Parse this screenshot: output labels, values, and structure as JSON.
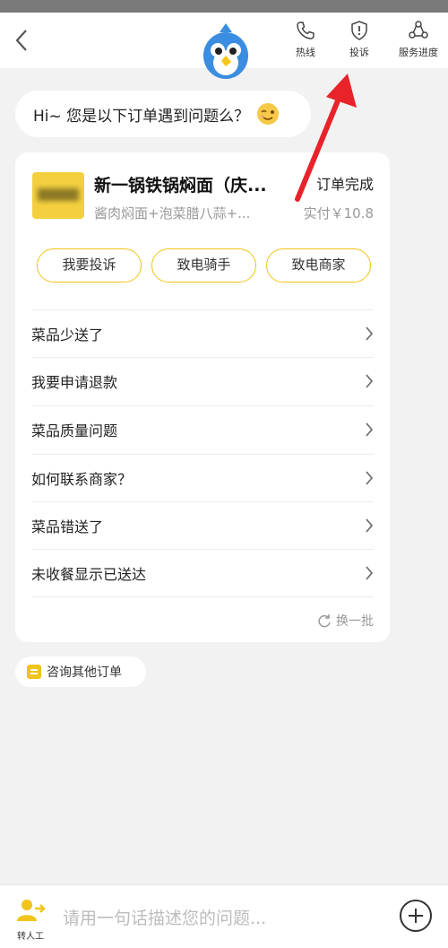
{
  "header": {
    "actions": [
      {
        "icon": "phone-icon",
        "label": "热线"
      },
      {
        "icon": "shield-icon",
        "label": "投诉"
      },
      {
        "icon": "progress-icon",
        "label": "服务进度"
      }
    ]
  },
  "greeting": {
    "text": "Hi~ 您是以下订单遇到问题么？",
    "emoji": "wink-emoji-icon"
  },
  "order": {
    "store_name": "新一锅铁锅焖面（庆...",
    "status": "订单完成",
    "items": "酱肉焖面+泡菜腊八蒜+...",
    "paid": "实付￥10.8"
  },
  "order_actions": [
    "我要投诉",
    "致电骑手",
    "致电商家"
  ],
  "questions": [
    "菜品少送了",
    "我要申请退款",
    "菜品质量问题",
    "如何联系商家？",
    "菜品错送了",
    "未收餐显示已送达"
  ],
  "refresh_label": "换一批",
  "other_orders_label": "咨询其他订单",
  "bottom": {
    "agent_label": "转人工",
    "input_placeholder": "请用一句话描述您的问题..."
  },
  "colors": {
    "accent": "#f0c419",
    "background": "#f2f2f2",
    "annotation_arrow": "#e8232a"
  }
}
